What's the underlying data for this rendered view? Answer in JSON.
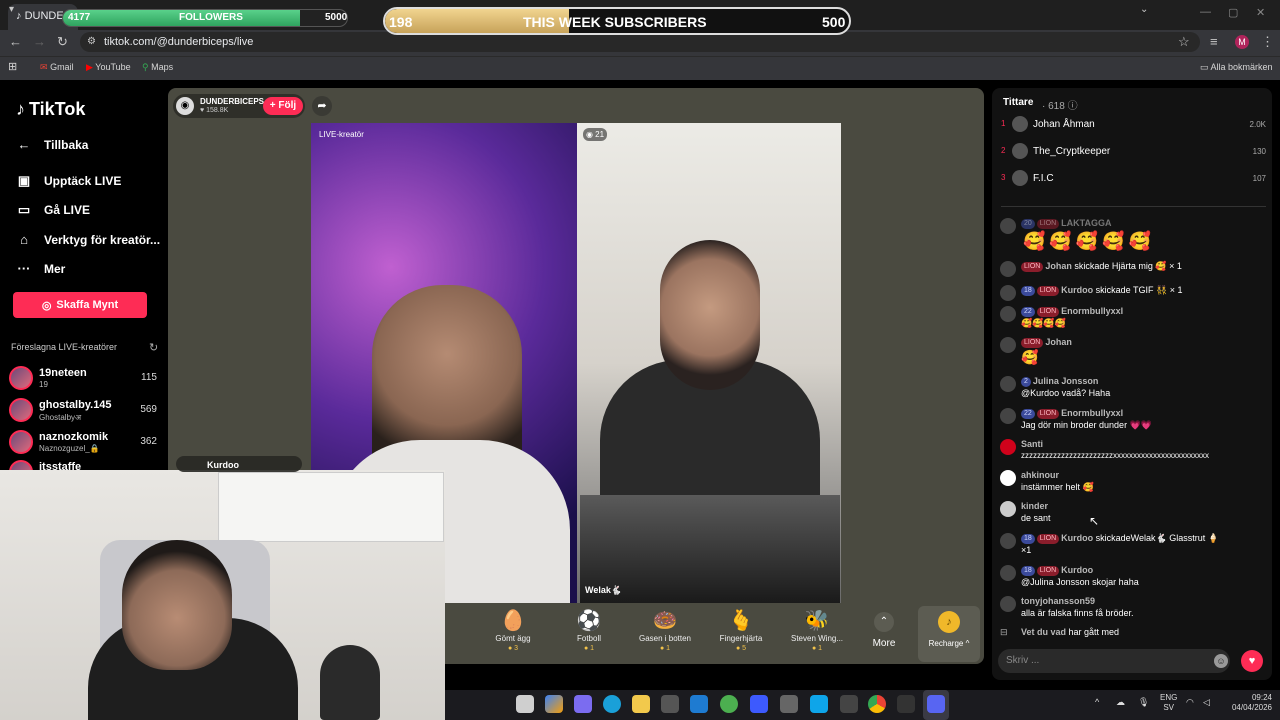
{
  "browser": {
    "tab_title": "DUNDE",
    "url": "tiktok.com/@dunderbiceps/live",
    "bookmarks": [
      "Gmail",
      "YouTube",
      "Maps"
    ],
    "all_bookmarks": "Alla bokmärken",
    "profile_initial": "M"
  },
  "overlay": {
    "followers_current": "4177",
    "followers_label": "FOLLOWERS",
    "followers_goal": "5000",
    "followers_progress": 0.835,
    "subs_current": "198",
    "subs_label": "THIS WEEK SUBSCRIBERS",
    "subs_goal": "500",
    "subs_progress": 0.396
  },
  "sidebar": {
    "logo": "TikTok",
    "back": "Tillbaka",
    "items": [
      {
        "label": "Upptäck LIVE",
        "icon": "live-icon"
      },
      {
        "label": "Gå LIVE",
        "icon": "camera-icon"
      },
      {
        "label": "Verktyg för kreatör...",
        "icon": "home-icon"
      },
      {
        "label": "Mer",
        "icon": "more-icon"
      }
    ],
    "coins_button": "Skaffa Mynt",
    "suggested_title": "Föreslagna LIVE-kreatörer",
    "creators": [
      {
        "name": "19neteen",
        "sub": "19",
        "count": "115"
      },
      {
        "name": "ghostalby.145",
        "sub": "Ghostalbyअ",
        "count": "569"
      },
      {
        "name": "naznozkomik",
        "sub": "Naznozguzel_🔒",
        "count": "362"
      },
      {
        "name": "itsstaffe",
        "sub": "",
        "count": ""
      }
    ]
  },
  "stage": {
    "streamer_name": "DUNDERBICEPS",
    "streamer_likes": "158.8K",
    "follow_label": "+ Följ",
    "live_label": "LIVE-kreatör",
    "viewer_badge": "21",
    "guest_name": "Welak🐇",
    "kurdoo_label": "Kurdoo",
    "gifts": [
      {
        "icon": "🥚",
        "name": "Gömt ägg",
        "price": "3"
      },
      {
        "icon": "⚽",
        "name": "Fotboll",
        "price": "1"
      },
      {
        "icon": "🍩",
        "name": "Gasen i botten",
        "price": "1"
      },
      {
        "icon": "🫰",
        "name": "Fingerhjärta",
        "price": "5"
      },
      {
        "icon": "🐝",
        "name": "Steven Wing...",
        "price": "1"
      }
    ],
    "more_label": "More",
    "recharge_label": "Recharge ^"
  },
  "panel": {
    "viewers_title": "Tittare",
    "viewers_count": "· 618",
    "top_viewers": [
      {
        "rank": "1",
        "name": "Johan Åhman",
        "score": "2.0K"
      },
      {
        "rank": "2",
        "name": "The_Cryptkeeper",
        "score": "130"
      },
      {
        "rank": "3",
        "name": "F.I.C",
        "score": "107"
      }
    ],
    "messages": [
      {
        "level": "20",
        "lion": "LION",
        "user": "LAKTAGGA",
        "text": ""
      },
      {
        "level": "",
        "lion": "LION",
        "user": "Johan",
        "text": "skickade Hjärta mig 🥰 × 1"
      },
      {
        "level": "18",
        "lion": "LION",
        "user": "Kurdoo",
        "text": "skickade TGIF 👯 × 1"
      },
      {
        "level": "22",
        "lion": "LION",
        "user": "Enormbullyxxl",
        "text": "🥰🥰🥰🥰"
      },
      {
        "level": "",
        "lion": "LION",
        "user": "Johan",
        "text": "🥰"
      },
      {
        "level": "2",
        "lion": "",
        "user": "Julina Jonsson",
        "text": "@Kurdoo vadå? Haha"
      },
      {
        "level": "22",
        "lion": "LION",
        "user": "Enormbullyxxl",
        "text": "Jag dör min broder dunder 💗💗"
      },
      {
        "level": "",
        "lion": "",
        "user": "Santi",
        "text": "zzzzzzzzzzzzzzzzzzzzzzzxxxxxxxxxxxxxxxxxxxxxxxx"
      },
      {
        "level": "",
        "lion": "",
        "user": "ahkinour",
        "text": "instämmer helt 🥰"
      },
      {
        "level": "",
        "lion": "",
        "user": "kinder",
        "text": "de sant"
      },
      {
        "level": "18",
        "lion": "LION",
        "user": "Kurdoo",
        "text": "skickadeWelak🐇  Glasstrut 🍦"
      },
      {
        "level": "18",
        "lion": "LION",
        "user": "Kurdoo",
        "text": "@Julina Jonsson skojar haha"
      },
      {
        "level": "",
        "lion": "",
        "user": "tonyjohansson59",
        "text": "alla är falska finns få bröder."
      },
      {
        "level": "",
        "lion": "",
        "user": "Vet du vad",
        "text": "har gått med"
      }
    ],
    "kurdoo_line2": "×1",
    "laktagga_emojis": "🥰🥰🥰🥰🥰",
    "input_placeholder": "Skriv ..."
  },
  "taskbar": {
    "lang": "ENG",
    "lang_sub": "SV",
    "time": "09:24",
    "date": "04/04/2026"
  },
  "colors": {
    "brand": "#fe2c55",
    "lion": "#8a1d2b",
    "level": "#3b4a9b"
  }
}
